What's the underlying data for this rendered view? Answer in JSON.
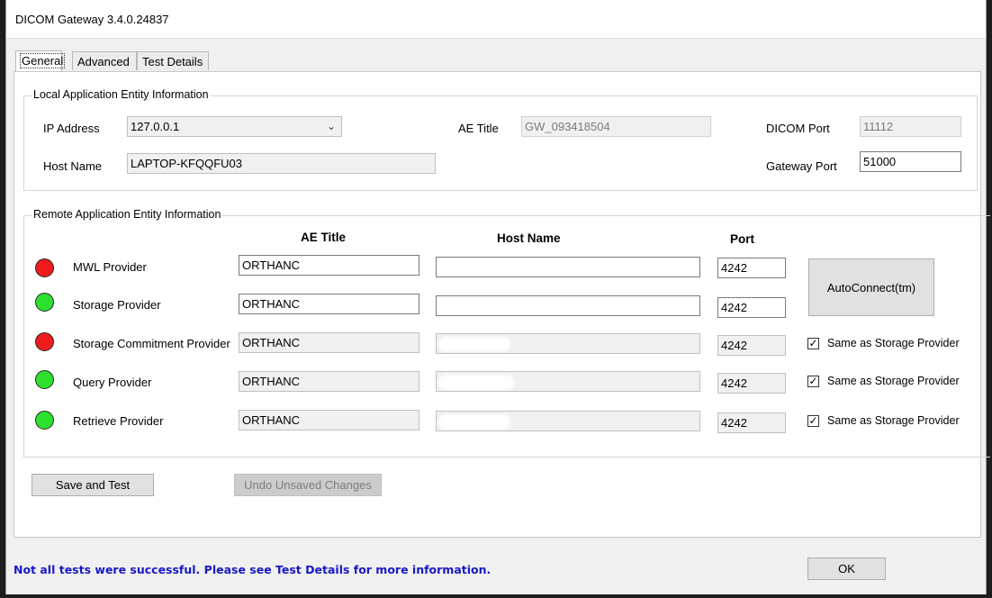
{
  "window": {
    "title": "DICOM Gateway 3.4.0.24837"
  },
  "tabs": [
    {
      "label": "General",
      "active": true
    },
    {
      "label": "Advanced",
      "active": false
    },
    {
      "label": "Test Details",
      "active": false
    }
  ],
  "local": {
    "group_title": "Local Application Entity Information",
    "ip_label": "IP Address",
    "ip_value": "127.0.0.1",
    "host_label": "Host Name",
    "host_value": "LAPTOP-KFQQFU03",
    "ae_title_label": "AE Title",
    "ae_title_value": "GW_093418504",
    "dicom_port_label": "DICOM Port",
    "dicom_port_value": "11112",
    "gateway_port_label": "Gateway Port",
    "gateway_port_value": "51000"
  },
  "remote": {
    "group_title": "Remote Application Entity Information",
    "headers": {
      "ae_title": "AE Title",
      "host_name": "Host Name",
      "port": "Port"
    },
    "providers": [
      {
        "name": "MWL Provider",
        "status": "red",
        "ae_title": "ORTHANC",
        "host_name": "",
        "port": "4242"
      },
      {
        "name": "Storage Provider",
        "status": "green",
        "ae_title": "ORTHANC",
        "host_name": "",
        "port": "4242"
      },
      {
        "name": "Storage Commitment Provider",
        "status": "red",
        "ae_title": "ORTHANC",
        "host_name": "",
        "port": "4242",
        "same_as_storage": true
      },
      {
        "name": "Query Provider",
        "status": "green",
        "ae_title": "ORTHANC",
        "host_name": "",
        "port": "4242",
        "same_as_storage": true
      },
      {
        "name": "Retrieve Provider",
        "status": "green",
        "ae_title": "ORTHANC",
        "host_name": "",
        "port": "4242",
        "same_as_storage": true
      }
    ],
    "same_as_label": "Same as Storage Provider",
    "autoconnect_label": "AutoConnect(tm)"
  },
  "buttons": {
    "save_test": "Save and Test",
    "undo": "Undo Unsaved Changes",
    "ok": "OK"
  },
  "status_message": "Not all tests were successful. Please see Test Details for more information.",
  "colors": {
    "status_red": "#ee1c1c",
    "status_green": "#2ee02e",
    "status_text": "#1818c8"
  }
}
